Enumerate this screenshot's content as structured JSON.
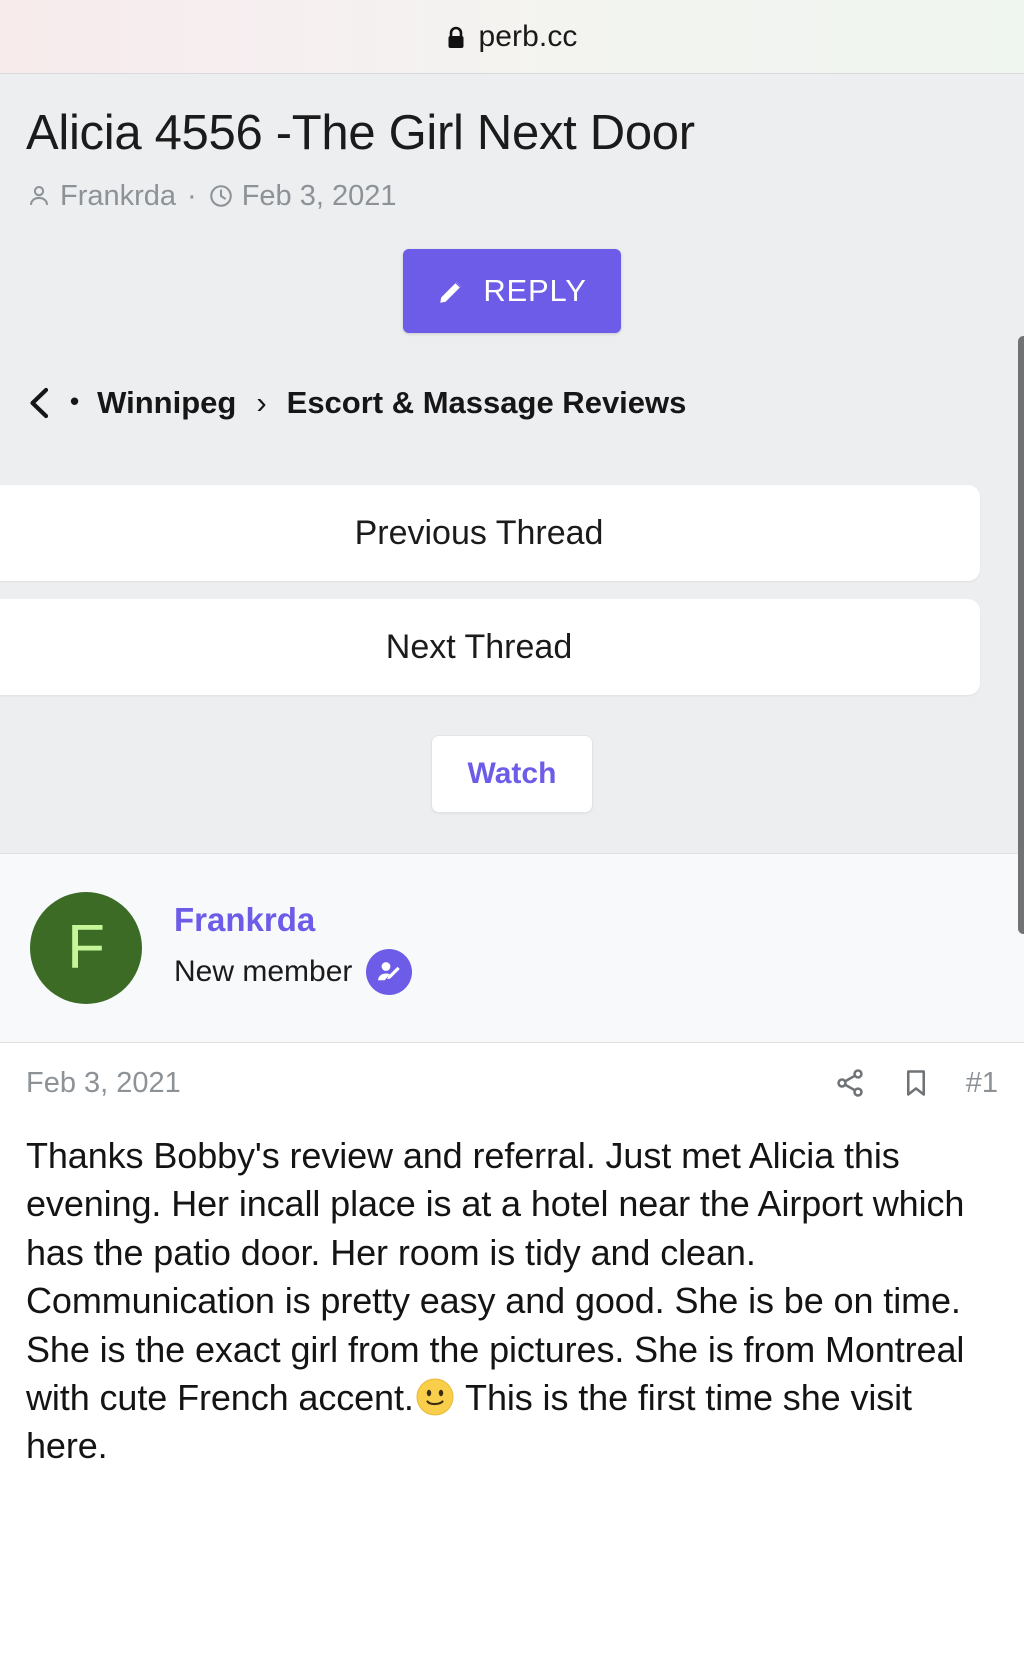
{
  "browser": {
    "url": "perb.cc",
    "lock_icon": "lock-icon"
  },
  "thread": {
    "title": "Alicia 4556 -The Girl Next Door",
    "author": "Frankrda",
    "author_icon": "person-icon",
    "date": "Feb 3, 2021",
    "date_icon": "clock-icon",
    "separator": "·"
  },
  "actions": {
    "reply_label": "REPLY",
    "reply_icon": "pencil-icon",
    "reply_color": "#6c5ce7"
  },
  "breadcrumb": {
    "back_icon": "chevron-left-icon",
    "bullet": "•",
    "forum": "Winnipeg",
    "caret": "›",
    "section": "Escort & Massage Reviews"
  },
  "nav": {
    "previous_label": "Previous Thread",
    "next_label": "Next Thread",
    "watch_label": "Watch"
  },
  "post": {
    "avatar_letter": "F",
    "avatar_color": "#3c6b26",
    "avatar_text_color": "#c6f59a",
    "author_name": "Frankrda",
    "author_rank": "New member",
    "rank_badge_icon": "member-edit-badge-icon",
    "date": "Feb 3, 2021",
    "share_icon": "share-icon",
    "bookmark_icon": "bookmark-icon",
    "post_number": "#1",
    "body_part_1": "Thanks Bobby's review and referral. Just met Alicia this evening. Her incall place is at a hotel near the Airport which has the patio door. Her room is tidy and clean. Communication is pretty easy and good. She is be on time. She is the exact girl from the pictures. She is from Montreal with cute French accent.",
    "body_emoji": "slight-smile-emoji",
    "body_part_2": " This is the first time she visit here."
  },
  "scrollbar": {
    "thumb_color": "#6f7376"
  }
}
